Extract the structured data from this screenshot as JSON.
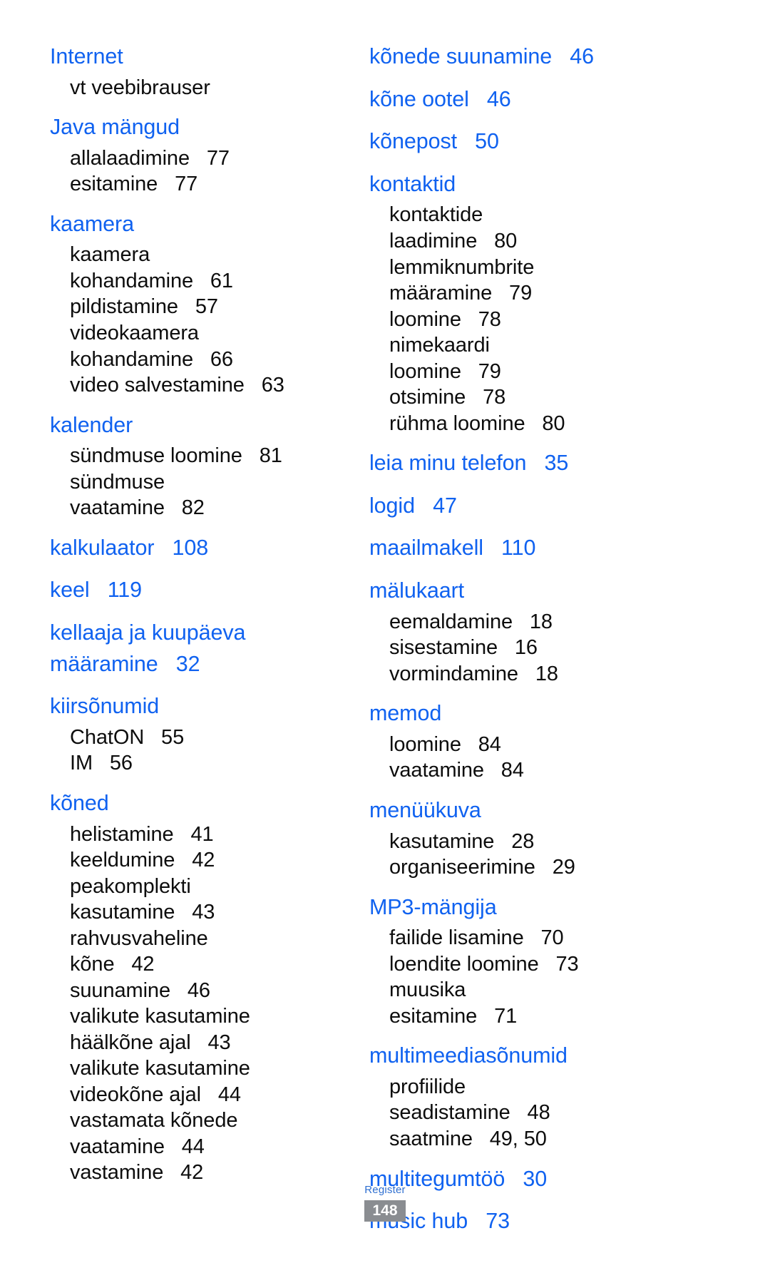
{
  "document": {
    "kind": "index-page",
    "language": "et",
    "footer": {
      "label": "Register",
      "page_number": "148"
    },
    "colors": {
      "heading": "#1062f0",
      "body": "#0d0d0d",
      "footer_label": "#2f6fd0",
      "page_badge_bg": "#8a8d91",
      "page_badge_text": "#ffffff",
      "background": "#ffffff"
    }
  },
  "columns": [
    {
      "name": "left-column",
      "entries": [
        {
          "type": "head",
          "label": "Internet",
          "page": ""
        },
        {
          "type": "sub",
          "label": "vt veebibrauser",
          "page": ""
        },
        {
          "type": "head",
          "label": "Java mängud",
          "page": ""
        },
        {
          "type": "sub",
          "label": "allalaadimine",
          "page": "77"
        },
        {
          "type": "sub",
          "label": "esitamine",
          "page": "77"
        },
        {
          "type": "head",
          "label": "kaamera",
          "page": ""
        },
        {
          "type": "sub",
          "label": "kaamera kohandamine",
          "page": "61"
        },
        {
          "type": "sub",
          "label": "pildistamine",
          "page": "57"
        },
        {
          "type": "sub",
          "label": "videokaamera",
          "page": ""
        },
        {
          "type": "sub",
          "label": "kohandamine",
          "page": "66"
        },
        {
          "type": "sub",
          "label": "video salvestamine",
          "page": "63"
        },
        {
          "type": "head",
          "label": "kalender",
          "page": ""
        },
        {
          "type": "sub",
          "label": "sündmuse loomine",
          "page": "81"
        },
        {
          "type": "sub",
          "label": "sündmuse vaatamine",
          "page": "82"
        },
        {
          "type": "head",
          "label": "kalkulaator",
          "page": "108"
        },
        {
          "type": "head",
          "label": "keel",
          "page": "119"
        },
        {
          "type": "head",
          "label": "kellaaja ja kuupäeva",
          "page": ""
        },
        {
          "type": "head-cont",
          "label": "määramine",
          "page": "32"
        },
        {
          "type": "head",
          "label": "kiirsõnumid",
          "page": ""
        },
        {
          "type": "sub",
          "label": "ChatON",
          "page": "55"
        },
        {
          "type": "sub",
          "label": "IM",
          "page": "56"
        },
        {
          "type": "head",
          "label": "kõned",
          "page": ""
        },
        {
          "type": "sub",
          "label": "helistamine",
          "page": "41"
        },
        {
          "type": "sub",
          "label": "keeldumine",
          "page": "42"
        },
        {
          "type": "sub",
          "label": "peakomplekti",
          "page": ""
        },
        {
          "type": "sub",
          "label": "kasutamine",
          "page": "43"
        },
        {
          "type": "sub",
          "label": "rahvusvaheline kõne",
          "page": "42"
        },
        {
          "type": "sub",
          "label": "suunamine",
          "page": "46"
        },
        {
          "type": "sub",
          "label": "valikute kasutamine",
          "page": ""
        },
        {
          "type": "sub",
          "label": "häälkõne ajal",
          "page": "43"
        },
        {
          "type": "sub",
          "label": "valikute kasutamine",
          "page": ""
        },
        {
          "type": "sub",
          "label": "videokõne ajal",
          "page": "44"
        },
        {
          "type": "sub",
          "label": "vastamata kõnede",
          "page": ""
        },
        {
          "type": "sub",
          "label": "vaatamine",
          "page": "44"
        },
        {
          "type": "sub",
          "label": "vastamine",
          "page": "42"
        }
      ]
    },
    {
      "name": "right-column",
      "entries": [
        {
          "type": "head",
          "label": "kõnede suunamine",
          "page": "46"
        },
        {
          "type": "head",
          "label": "kõne ootel",
          "page": "46"
        },
        {
          "type": "head",
          "label": "kõnepost",
          "page": "50"
        },
        {
          "type": "head",
          "label": "kontaktid",
          "page": ""
        },
        {
          "type": "sub",
          "label": "kontaktide laadimine",
          "page": "80"
        },
        {
          "type": "sub",
          "label": "lemmiknumbrite",
          "page": ""
        },
        {
          "type": "sub",
          "label": "määramine",
          "page": "79"
        },
        {
          "type": "sub",
          "label": "loomine",
          "page": "78"
        },
        {
          "type": "sub",
          "label": "nimekaardi loomine",
          "page": "79"
        },
        {
          "type": "sub",
          "label": "otsimine",
          "page": "78"
        },
        {
          "type": "sub",
          "label": "rühma loomine",
          "page": "80"
        },
        {
          "type": "head",
          "label": "leia minu telefon",
          "page": "35"
        },
        {
          "type": "head",
          "label": "logid",
          "page": "47"
        },
        {
          "type": "head",
          "label": "maailmakell",
          "page": "110"
        },
        {
          "type": "head",
          "label": "mälukaart",
          "page": ""
        },
        {
          "type": "sub",
          "label": "eemaldamine",
          "page": "18"
        },
        {
          "type": "sub",
          "label": "sisestamine",
          "page": "16"
        },
        {
          "type": "sub",
          "label": "vormindamine",
          "page": "18"
        },
        {
          "type": "head",
          "label": "memod",
          "page": ""
        },
        {
          "type": "sub",
          "label": "loomine",
          "page": "84"
        },
        {
          "type": "sub",
          "label": "vaatamine",
          "page": "84"
        },
        {
          "type": "head",
          "label": "menüükuva",
          "page": ""
        },
        {
          "type": "sub",
          "label": "kasutamine",
          "page": "28"
        },
        {
          "type": "sub",
          "label": "organiseerimine",
          "page": "29"
        },
        {
          "type": "head",
          "label": "MP3-mängija",
          "page": ""
        },
        {
          "type": "sub",
          "label": "failide lisamine",
          "page": "70"
        },
        {
          "type": "sub",
          "label": "loendite loomine",
          "page": "73"
        },
        {
          "type": "sub",
          "label": "muusika esitamine",
          "page": "71"
        },
        {
          "type": "head",
          "label": "multimeediasõnumid",
          "page": ""
        },
        {
          "type": "sub",
          "label": "profiilide seadistamine",
          "page": "48"
        },
        {
          "type": "sub",
          "label": "saatmine",
          "page": "49, 50"
        },
        {
          "type": "head",
          "label": "multitegumtöö",
          "page": "30"
        },
        {
          "type": "head",
          "label": "music hub",
          "page": "73"
        }
      ]
    }
  ]
}
